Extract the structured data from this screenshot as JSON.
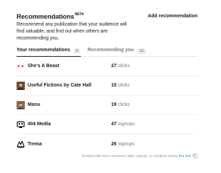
{
  "header": {
    "title": "Recommendations",
    "beta_badge": "BETA",
    "add_button_label": "Add recommendation"
  },
  "description": "Recommend any publication that your audience will find valuable, and find out when others are recommending you.",
  "tabs": [
    {
      "label": "Your recommendations",
      "count": "5",
      "active": true
    },
    {
      "label": "Recommending you",
      "count": "12",
      "active": false
    }
  ],
  "recommendations": [
    {
      "name": "She's A Beast",
      "value": "27",
      "unit": "clicks",
      "logo_icon": "red-stars-logo"
    },
    {
      "name": "Useful Fictions by Cate Hall",
      "value": "15",
      "unit": "clicks",
      "logo_icon": "portrait-logo"
    },
    {
      "name": "Manu",
      "value": "19",
      "unit": "clicks",
      "logo_icon": "portrait-logo"
    },
    {
      "name": "404 Media",
      "value": "47",
      "unit": "signups",
      "logo_icon": "404-media-logo"
    },
    {
      "name": "Trema",
      "value": "26",
      "unit": "signups",
      "logo_icon": "trema-logo"
    }
  ],
  "footer": {
    "text": "Shared with new members after signup, or anytime using",
    "link_text": "this link",
    "icon": "copy-icon"
  },
  "colors": {
    "link_green": "#3aa757",
    "muted_text": "#7a7a7a",
    "badge_bg": "#ececec"
  }
}
